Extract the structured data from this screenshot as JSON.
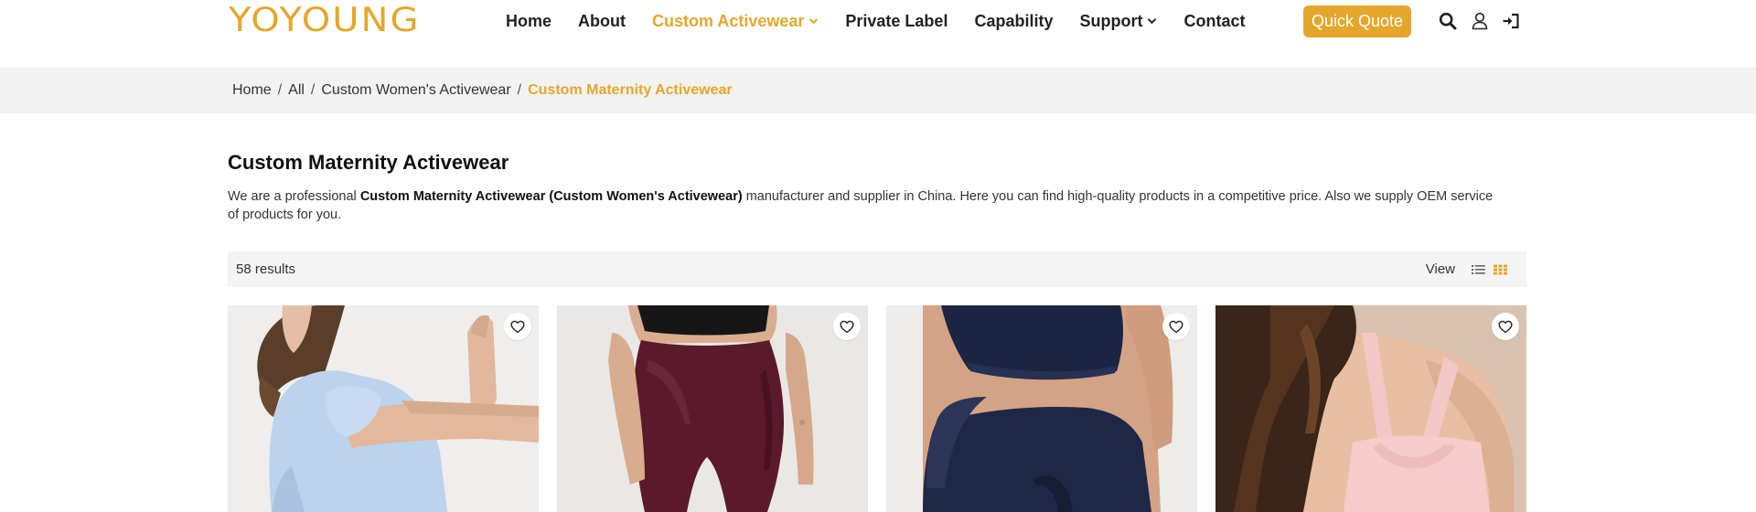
{
  "brand": {
    "logo_text": "YOYOUNG",
    "accent_color": "#E4A72B"
  },
  "nav": {
    "items": [
      {
        "label": "Home",
        "active": false,
        "dropdown": false
      },
      {
        "label": "About",
        "active": false,
        "dropdown": false
      },
      {
        "label": "Custom Activewear",
        "active": true,
        "dropdown": true
      },
      {
        "label": "Private Label",
        "active": false,
        "dropdown": false
      },
      {
        "label": "Capability",
        "active": false,
        "dropdown": false
      },
      {
        "label": "Support",
        "active": false,
        "dropdown": true
      },
      {
        "label": "Contact",
        "active": false,
        "dropdown": false
      }
    ],
    "quote_button": "Quick Quote",
    "icons": [
      "search-icon",
      "user-icon",
      "sign-in-icon"
    ]
  },
  "breadcrumb": {
    "items": [
      "Home",
      "All",
      "Custom Women's Activewear"
    ],
    "separator": "/",
    "current": "Custom Maternity Activewear"
  },
  "category": {
    "title": "Custom Maternity Activewear",
    "desc_prefix": "We are a professional ",
    "desc_bold": "Custom Maternity Activewear (Custom Women's Activewear)",
    "desc_suffix": " manufacturer and supplier in China. Here you can find high-quality products in a competitive price. Also we supply OEM service of products for you."
  },
  "results": {
    "count_text": "58 results",
    "view_label": "View",
    "view_modes": [
      "list-view-icon",
      "grid-view-icon"
    ],
    "active_view": "grid"
  },
  "products": [
    {
      "image": "woman-in-light-blue-tee-photo",
      "wishlist_icon": "heart-icon"
    },
    {
      "image": "burgundy-maternity-leggings-photo",
      "wishlist_icon": "heart-icon"
    },
    {
      "image": "navy-maternity-set-photo",
      "wishlist_icon": "heart-icon"
    },
    {
      "image": "pink-nursing-bra-back-photo",
      "wishlist_icon": "heart-icon"
    }
  ]
}
